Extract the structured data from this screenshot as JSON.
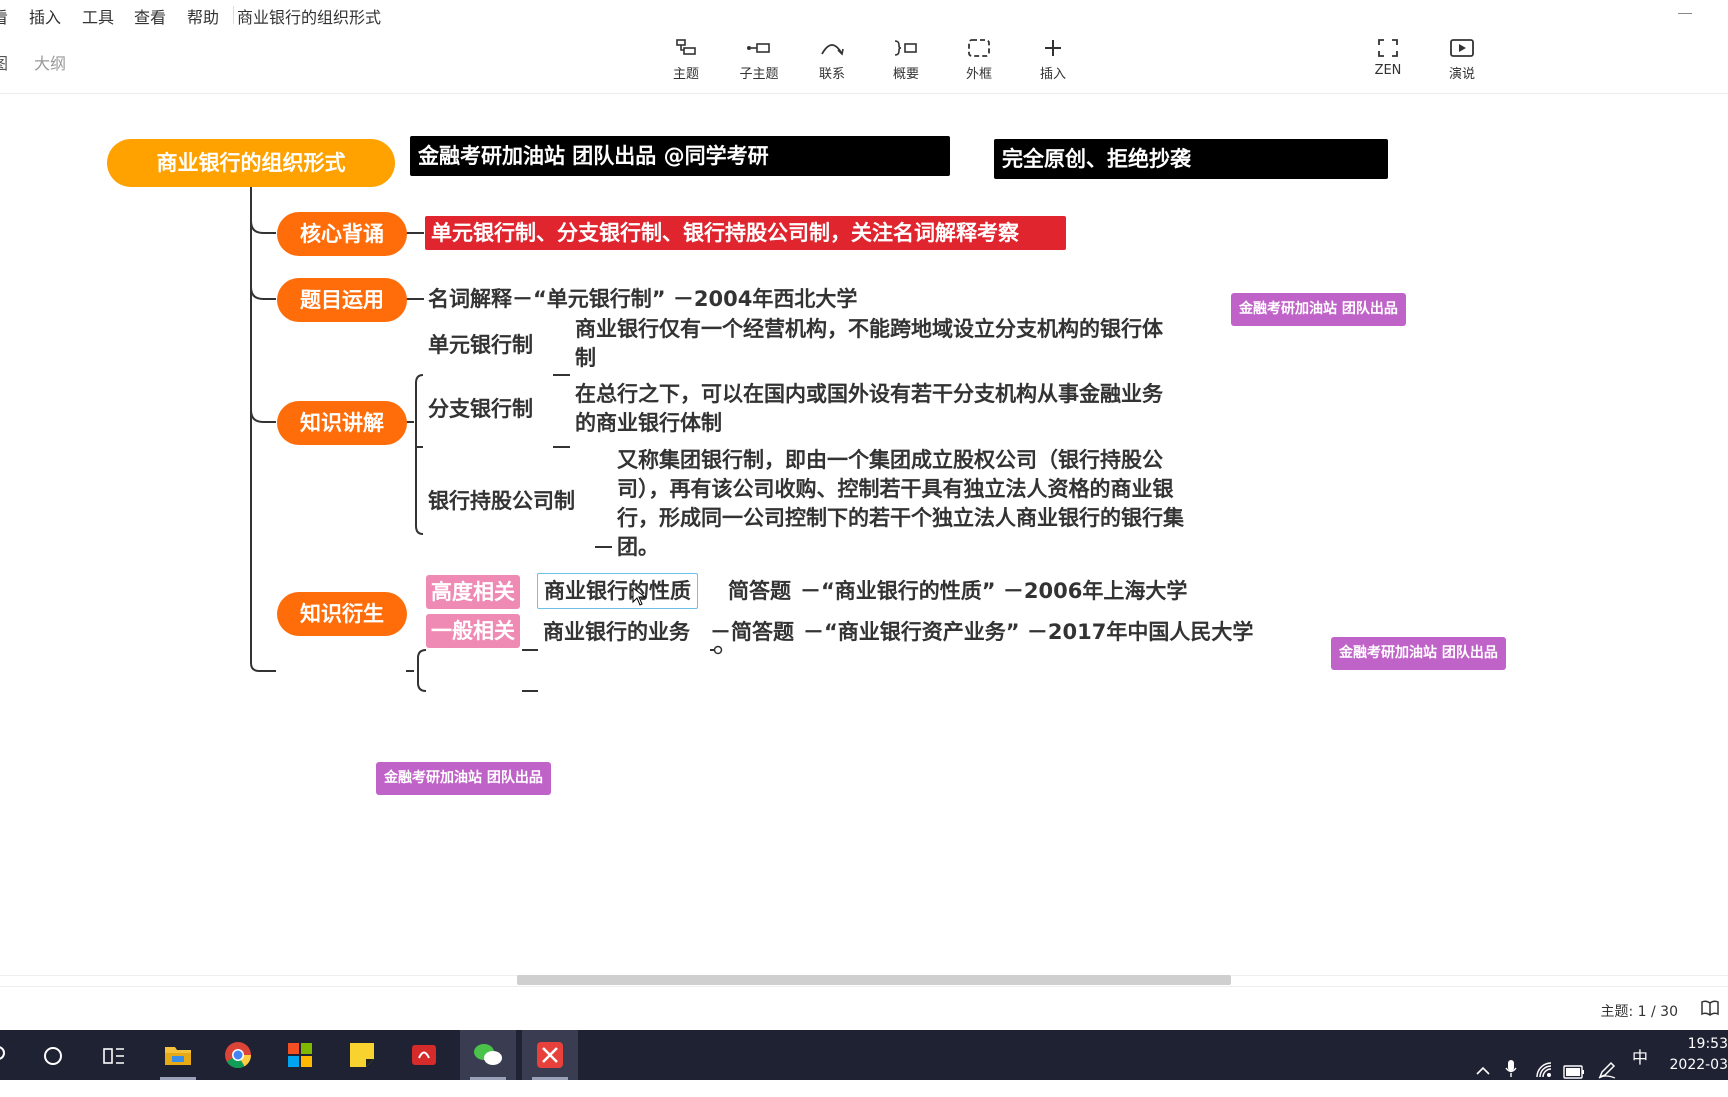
{
  "menu": {
    "partial_first": "看",
    "items": [
      "插入",
      "工具",
      "查看",
      "帮助"
    ],
    "doc_title": "商业银行的组织形式"
  },
  "sidebar_tabs": {
    "outline_label": "大纲",
    "left_partial": "图"
  },
  "toolbar": {
    "buttons": [
      {
        "label": "主题",
        "icon": "topic-icon"
      },
      {
        "label": "子主题",
        "icon": "subtopic-icon"
      },
      {
        "label": "联系",
        "icon": "relationship-icon"
      },
      {
        "label": "概要",
        "icon": "summary-icon"
      },
      {
        "label": "外框",
        "icon": "boundary-icon"
      },
      {
        "label": "插入",
        "icon": "plus-icon"
      }
    ],
    "right_buttons": [
      {
        "label": "ZEN",
        "icon": "fullscreen-icon"
      },
      {
        "label": "演说",
        "icon": "present-icon"
      }
    ]
  },
  "map": {
    "root": "商业银行的组织形式",
    "banner_1": "金融考研加油站 团队出品 @同学考研",
    "banner_2": "完全原创、拒绝抄袭",
    "core": {
      "label": "核心背诵",
      "text": "单元银行制、分支银行制、银行持股公司制，关注名词解释考察"
    },
    "usage": {
      "label": "题目运用",
      "text": "名词解释－“单元银行制” －2004年西北大学"
    },
    "knowledge": {
      "label": "知识讲解",
      "items": [
        {
          "term": "单元银行制",
          "lines": [
            "商业银行仅有一个经营机构，不能跨地域设立分支机构的银行体",
            "制"
          ]
        },
        {
          "term": "分支银行制",
          "lines": [
            "在总行之下，可以在国内或国外设有若干分支机构从事金融业务",
            "的商业银行体制"
          ]
        },
        {
          "term": "银行持股公司制",
          "lines": [
            "又称集团银行制，即由一个集团成立股权公司（银行持股公",
            "司），再有该公司收购、控制若干具有独立法人资格的商业银",
            "行，形成同一公司控制下的若干个独立法人商业银行的银行集",
            "团。"
          ]
        }
      ]
    },
    "derived": {
      "label": "知识衍生",
      "high": {
        "tag": "高度相关",
        "topic": "商业银行的性质",
        "type": "简答题",
        "rest": "－“商业银行的性质” －2006年上海大学"
      },
      "general": {
        "tag": "一般相关",
        "topic": "商业银行的业务",
        "type": "－简答题",
        "rest": "－“商业银行资产业务” －2017年中国人民大学"
      }
    },
    "watermarks": [
      "金融考研加油站  团队出品",
      "金融考研加油站  团队出品",
      "金融考研加油站  团队出品"
    ]
  },
  "status": {
    "topic_count": "主题: 1 / 30"
  },
  "taskbar": {
    "ime": "中",
    "time": "19:53",
    "date": "2022-03"
  }
}
